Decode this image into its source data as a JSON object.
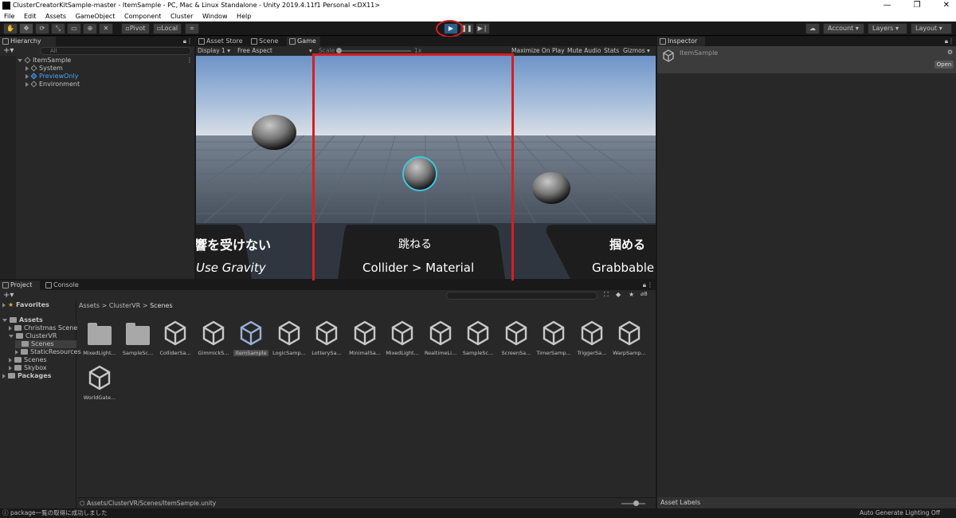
{
  "window": {
    "title": "ClusterCreatorKitSample-master - ItemSample - PC, Mac & Linux Standalone - Unity 2019.4.11f1 Personal <DX11>",
    "controls": [
      "—",
      "❐",
      "✕"
    ]
  },
  "menu": [
    "File",
    "Edit",
    "Assets",
    "GameObject",
    "Component",
    "Cluster",
    "Window",
    "Help"
  ],
  "toolbar": {
    "pivot_label": "Pivot",
    "local_label": "Local",
    "account_label": "Account",
    "layers_label": "Layers",
    "layout_label": "Layout"
  },
  "hierarchy": {
    "tab_label": "Hierarchy",
    "search_placeholder": "All",
    "scene": "ItemSample",
    "items": [
      "System",
      "PreviewOnly",
      "Environment"
    ]
  },
  "center_tabs": [
    "Asset Store",
    "Scene",
    "Game"
  ],
  "game_toolbar": {
    "display": "Display 1",
    "aspect": "Free Aspect",
    "scale_label": "Scale",
    "scale_value": "1x",
    "maximize": "Maximize On Play",
    "mute": "Mute Audio",
    "stats": "Stats",
    "gizmos": "Gizmos"
  },
  "game_signs": {
    "left_jp": "響を受けない",
    "left_en": "Use Gravity",
    "center_jp": "跳ねる",
    "center_en": "Collider > Material",
    "right_jp": "掴める",
    "right_en": "Grabbable"
  },
  "inspector": {
    "tab_label": "Inspector",
    "object_name": "ItemSample",
    "open_label": "Open",
    "asset_labels": "Asset Labels"
  },
  "project": {
    "tabs": [
      "Project",
      "Console"
    ],
    "breadcrumb": [
      "Assets",
      "ClusterVR",
      "Scenes"
    ],
    "badge_count": "8",
    "tree": {
      "favorites": "Favorites",
      "assets": "Assets",
      "children": [
        "Christmas Scene",
        "ClusterVR",
        "Scenes",
        "StaticResources",
        "Scenes",
        "Skybox"
      ],
      "packages": "Packages"
    },
    "files": [
      "MixedLight...",
      "SampleSc...",
      "ColliderSa...",
      "GimmickS...",
      "ItemSample",
      "LogicSamp...",
      "LotterySa...",
      "MinimalSa...",
      "MixedLight...",
      "RealtimeLi...",
      "SampleSc...",
      "ScreenSa...",
      "TimerSamp...",
      "TriggerSa...",
      "WarpSamp...",
      "WorldGate..."
    ],
    "path": "Assets/ClusterVR/Scenes/ItemSample.unity"
  },
  "status": {
    "message": "package一覧の取得に成功しました",
    "right": "Auto Generate Lighting Off"
  },
  "colors": {
    "highlight_red": "#d42020",
    "selection_cyan": "#3ac8e0",
    "preview_blue": "#4aa3f0"
  }
}
